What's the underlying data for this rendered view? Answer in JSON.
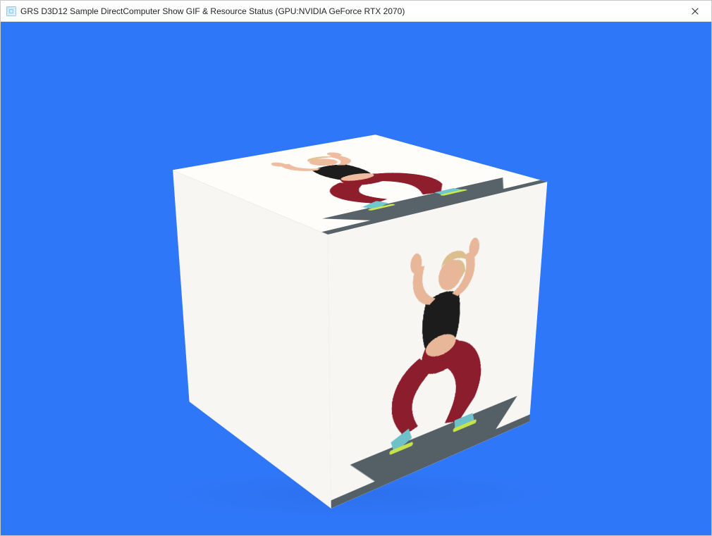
{
  "window": {
    "title": "GRS D3D12 Sample DirectComputer Show GIF & Resource Status (GPU:NVIDIA GeForce RTX 2070)"
  },
  "scene": {
    "background_color": "#2f77f9",
    "cube_face_bg": "#f7f6f3",
    "mat_color": "#556066",
    "texture": {
      "description": "exercise-lunge-figure",
      "top_color": "#1c1c1c",
      "leg_color": "#8b1d2c",
      "skin_color": "#e8b79a",
      "hair_color": "#dbbf8f",
      "shoe_sole": "#c7e34a",
      "shoe_body": "#6ec1c8"
    }
  }
}
